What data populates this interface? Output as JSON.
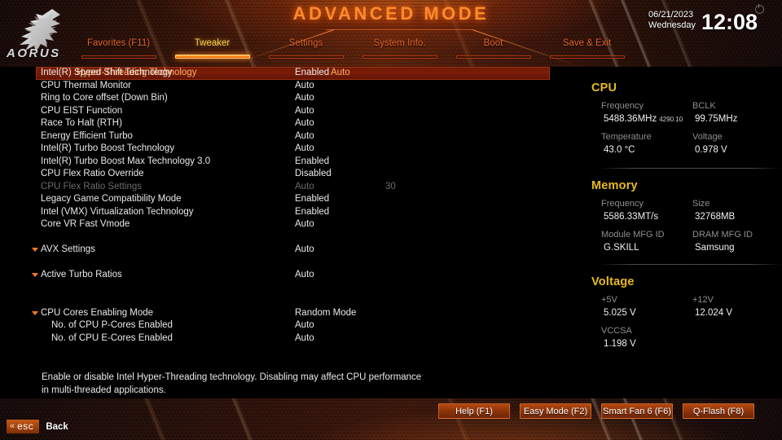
{
  "header": {
    "title": "ADVANCED MODE",
    "brand": "AORUS",
    "date": "06/21/2023",
    "weekday": "Wednesday",
    "time": "12:08",
    "power_icon": "power-icon"
  },
  "nav": {
    "tabs": [
      {
        "label": "Favorites (F11)",
        "active": false
      },
      {
        "label": "Tweaker",
        "active": true
      },
      {
        "label": "Settings",
        "active": false
      },
      {
        "label": "System Info.",
        "active": false
      },
      {
        "label": "Boot",
        "active": false
      },
      {
        "label": "Save & Exit",
        "active": false
      }
    ]
  },
  "settings": {
    "rows": [
      {
        "name": "Hyper-Threading Technology",
        "value": "Auto",
        "extra": "",
        "selected": true,
        "dim": false,
        "indent": 0,
        "arrow": false
      },
      {
        "name": "Intel(R) Speed Shift Technology",
        "value": "Enabled",
        "extra": "",
        "selected": false,
        "dim": false,
        "indent": 0,
        "arrow": false
      },
      {
        "name": "CPU Thermal Monitor",
        "value": "Auto",
        "extra": "",
        "selected": false,
        "dim": false,
        "indent": 0,
        "arrow": false
      },
      {
        "name": "Ring to Core offset (Down Bin)",
        "value": "Auto",
        "extra": "",
        "selected": false,
        "dim": false,
        "indent": 0,
        "arrow": false
      },
      {
        "name": "CPU EIST Function",
        "value": "Auto",
        "extra": "",
        "selected": false,
        "dim": false,
        "indent": 0,
        "arrow": false
      },
      {
        "name": "Race To Halt (RTH)",
        "value": "Auto",
        "extra": "",
        "selected": false,
        "dim": false,
        "indent": 0,
        "arrow": false
      },
      {
        "name": "Energy Efficient Turbo",
        "value": "Auto",
        "extra": "",
        "selected": false,
        "dim": false,
        "indent": 0,
        "arrow": false
      },
      {
        "name": "Intel(R) Turbo Boost Technology",
        "value": "Auto",
        "extra": "",
        "selected": false,
        "dim": false,
        "indent": 0,
        "arrow": false
      },
      {
        "name": "Intel(R) Turbo Boost Max Technology 3.0",
        "value": "Enabled",
        "extra": "",
        "selected": false,
        "dim": false,
        "indent": 0,
        "arrow": false
      },
      {
        "name": "CPU Flex Ratio Override",
        "value": "Disabled",
        "extra": "",
        "selected": false,
        "dim": false,
        "indent": 0,
        "arrow": false
      },
      {
        "name": "CPU Flex Ratio Settings",
        "value": "Auto",
        "extra": "30",
        "selected": false,
        "dim": true,
        "indent": 0,
        "arrow": false
      },
      {
        "name": "Legacy Game Compatibility Mode",
        "value": "Enabled",
        "extra": "",
        "selected": false,
        "dim": false,
        "indent": 0,
        "arrow": false
      },
      {
        "name": "Intel (VMX) Virtualization Technology",
        "value": "Enabled",
        "extra": "",
        "selected": false,
        "dim": false,
        "indent": 0,
        "arrow": false
      },
      {
        "name": "Core VR Fast Vmode",
        "value": "Auto",
        "extra": "",
        "selected": false,
        "dim": false,
        "indent": 0,
        "arrow": false
      },
      {
        "spacer": true
      },
      {
        "name": "AVX Settings",
        "value": "Auto",
        "extra": "",
        "selected": false,
        "dim": false,
        "indent": 0,
        "arrow": true
      },
      {
        "spacer": true
      },
      {
        "name": "Active Turbo Ratios",
        "value": "Auto",
        "extra": "",
        "selected": false,
        "dim": false,
        "indent": 0,
        "arrow": true
      },
      {
        "spacer": true
      },
      {
        "spacer": true
      },
      {
        "name": "CPU Cores Enabling Mode",
        "value": "Random Mode",
        "extra": "",
        "selected": false,
        "dim": false,
        "indent": 0,
        "arrow": true
      },
      {
        "name": "No. of CPU P-Cores Enabled",
        "value": "Auto",
        "extra": "",
        "selected": false,
        "dim": false,
        "indent": 2,
        "arrow": false
      },
      {
        "name": "No. of CPU E-Cores Enabled",
        "value": "Auto",
        "extra": "",
        "selected": false,
        "dim": false,
        "indent": 2,
        "arrow": false
      }
    ]
  },
  "info_panel": {
    "sections": [
      {
        "title": "CPU",
        "cells": [
          {
            "label": "Frequency",
            "value": "5488.36MHz",
            "sub": "4290.10",
            "col": 0,
            "row": 0
          },
          {
            "label": "BCLK",
            "value": "99.75MHz",
            "sub": "",
            "col": 1,
            "row": 0
          },
          {
            "label": "Temperature",
            "value": "43.0 °C",
            "sub": "",
            "col": 0,
            "row": 1
          },
          {
            "label": "Voltage",
            "value": "0.978 V",
            "sub": "",
            "col": 1,
            "row": 1
          }
        ]
      },
      {
        "title": "Memory",
        "cells": [
          {
            "label": "Frequency",
            "value": "5586.33MT/s",
            "sub": "",
            "col": 0,
            "row": 0
          },
          {
            "label": "Size",
            "value": "32768MB",
            "sub": "",
            "col": 1,
            "row": 0
          },
          {
            "label": "Module MFG ID",
            "value": "G.SKILL",
            "sub": "",
            "col": 0,
            "row": 1
          },
          {
            "label": "DRAM MFG ID",
            "value": "Samsung",
            "sub": "",
            "col": 1,
            "row": 1
          }
        ]
      },
      {
        "title": "Voltage",
        "cells": [
          {
            "label": "+5V",
            "value": "5.025 V",
            "sub": "",
            "col": 0,
            "row": 0
          },
          {
            "label": "+12V",
            "value": "12.024 V",
            "sub": "",
            "col": 1,
            "row": 0
          },
          {
            "label": "VCCSA",
            "value": "1.198 V",
            "sub": "",
            "col": 0,
            "row": 1
          }
        ]
      }
    ]
  },
  "help": {
    "text": "Enable or disable Intel Hyper-Threading technology. Disabling may affect CPU performance in multi-threaded applications."
  },
  "footer": {
    "buttons": [
      {
        "label": "Help (F1)"
      },
      {
        "label": "Easy Mode (F2)"
      },
      {
        "label": "Smart Fan 6 (F6)"
      },
      {
        "label": "Q-Flash (F8)"
      }
    ],
    "esc_key": "esc",
    "esc_chevron": "«",
    "back_label": "Back"
  },
  "colors": {
    "accent_orange": "#ff7a18",
    "tab_text": "#e0622a",
    "tab_active_text": "#ffd24a",
    "panel_title": "#e8bb1e",
    "selected_row_bg": "#7a1d06",
    "selected_row_text": "#ffae6a"
  }
}
